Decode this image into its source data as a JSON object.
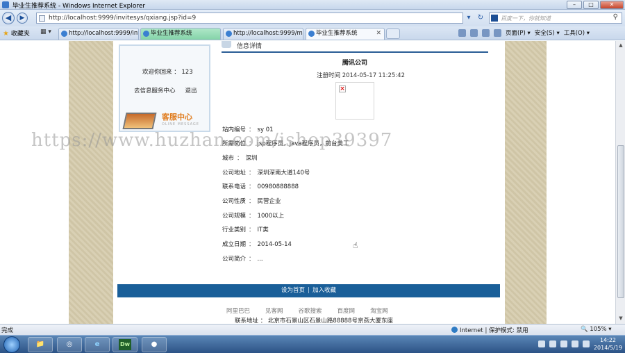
{
  "window": {
    "title": "毕业生推荐系统 - Windows Internet Explorer",
    "min": "–",
    "max": "□",
    "close": "✕"
  },
  "address": {
    "url": "http://localhost:9999/invitesys/qxiang.jsp?id=9",
    "refresh": "↻",
    "stop": "✕"
  },
  "search": {
    "placeholder": "百度一下，你就知道",
    "button": "⚲"
  },
  "favorites": {
    "label": "收藏夹"
  },
  "tabs": [
    {
      "label": "http://localhost:9999/inv..."
    },
    {
      "label": "毕业生推荐系统"
    },
    {
      "label": "http://localhost:9999/my..."
    },
    {
      "label": "毕业生推荐系统"
    }
  ],
  "commands": {
    "page": "页面(P) ▾",
    "safety": "安全(S) ▾",
    "tools": "工具(O) ▾"
  },
  "sidebar": {
    "welcome": "欢迎你回来 ： 123",
    "link_service": "去信息服务中心",
    "link_logout": "退出",
    "kefu_title": "客服中心",
    "kefu_sub": "OLINE MESSAGE"
  },
  "detail": {
    "header": "信息详情",
    "company_name": "腾讯公司",
    "register_time": "注册时间 2014-05-17 11:25:42",
    "fields": [
      {
        "label": "站内编号",
        "value": "sy 01"
      },
      {
        "label": "所需岗位",
        "value": "jsp程序员，java程序员，前台美工"
      },
      {
        "label": "城市",
        "value": "深圳"
      },
      {
        "label": "公司地址",
        "value": "深圳深南大道140号"
      },
      {
        "label": "联系电话",
        "value": "00980888888"
      },
      {
        "label": "公司性质",
        "value": "民营企业"
      },
      {
        "label": "公司规模",
        "value": "1000以上"
      },
      {
        "label": "行业类别",
        "value": "IT类"
      },
      {
        "label": "成立日期",
        "value": "2014-05-14"
      },
      {
        "label": "公司简介",
        "value": "..."
      }
    ]
  },
  "footer": {
    "set_home": "设为首页",
    "divider": "|",
    "add_fav": "加入收藏",
    "links": [
      "阿里巴巴",
      "见客网",
      "谷歌搜索",
      "百度网",
      "淘宝网"
    ],
    "address": "联系地址 ： 北京市石景山区石景山路88888号京燕大厦东座"
  },
  "watermark": "https://www.huzhan.com/ishop39397",
  "status": {
    "done": "完成",
    "zone": "Internet | 保护模式: 禁用",
    "zoom": "🔍 105% ▾"
  },
  "taskbar": {
    "dw_label": "Dw",
    "time": "14:22",
    "date": "2014/5/19"
  }
}
